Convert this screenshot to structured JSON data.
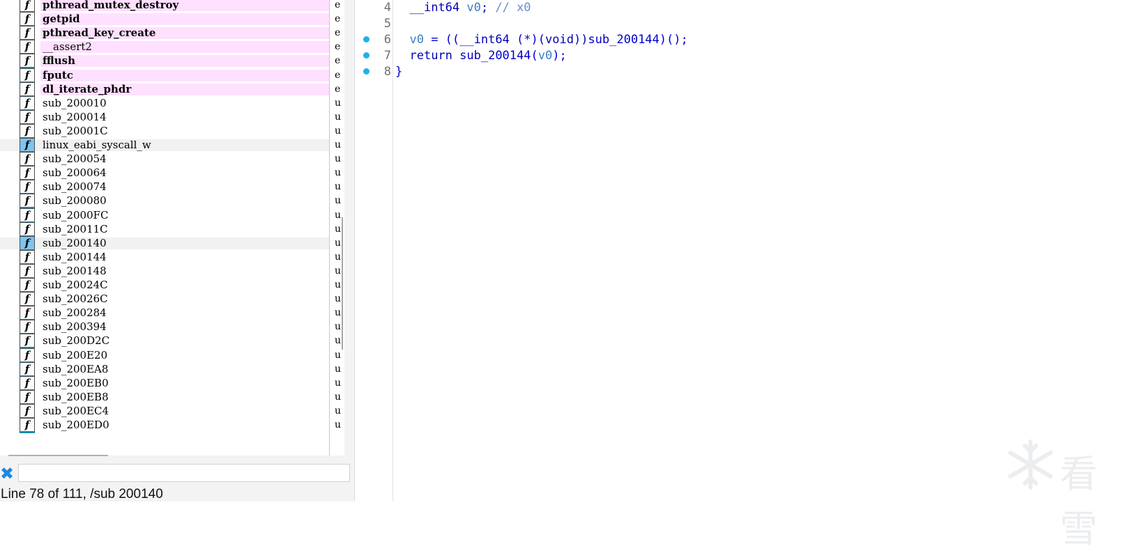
{
  "functions": [
    {
      "name": "pthread_mutex_destroy",
      "seg": "e",
      "type": "lib"
    },
    {
      "name": "getpid",
      "seg": "e",
      "type": "lib"
    },
    {
      "name": "pthread_key_create",
      "seg": "e",
      "type": "lib"
    },
    {
      "name": "__assert2",
      "seg": "e",
      "type": "lib-light"
    },
    {
      "name": "fflush",
      "seg": "e",
      "type": "lib"
    },
    {
      "name": "fputc",
      "seg": "e",
      "type": "lib"
    },
    {
      "name": "dl_iterate_phdr",
      "seg": "e",
      "type": "lib"
    },
    {
      "name": "sub_200010",
      "seg": "u",
      "type": "normal"
    },
    {
      "name": "sub_200014",
      "seg": "u",
      "type": "normal"
    },
    {
      "name": "sub_20001C",
      "seg": "u",
      "type": "normal"
    },
    {
      "name": "linux_eabi_syscall_w",
      "seg": "u",
      "type": "hover"
    },
    {
      "name": "sub_200054",
      "seg": "u",
      "type": "normal"
    },
    {
      "name": "sub_200064",
      "seg": "u",
      "type": "normal"
    },
    {
      "name": "sub_200074",
      "seg": "u",
      "type": "normal"
    },
    {
      "name": "sub_200080",
      "seg": "u",
      "type": "normal"
    },
    {
      "name": "sub_2000FC",
      "seg": "u",
      "type": "normal"
    },
    {
      "name": "sub_20011C",
      "seg": "u",
      "type": "normal"
    },
    {
      "name": "sub_200140",
      "seg": "u",
      "type": "selected"
    },
    {
      "name": "sub_200144",
      "seg": "u",
      "type": "normal"
    },
    {
      "name": "sub_200148",
      "seg": "u",
      "type": "normal"
    },
    {
      "name": "sub_20024C",
      "seg": "u",
      "type": "normal"
    },
    {
      "name": "sub_20026C",
      "seg": "u",
      "type": "normal"
    },
    {
      "name": "sub_200284",
      "seg": "u",
      "type": "normal"
    },
    {
      "name": "sub_200394",
      "seg": "u",
      "type": "normal"
    },
    {
      "name": "sub_200D2C",
      "seg": "u",
      "type": "normal"
    },
    {
      "name": "sub_200E20",
      "seg": "u",
      "type": "normal"
    },
    {
      "name": "sub_200EA8",
      "seg": "u",
      "type": "normal"
    },
    {
      "name": "sub_200EB0",
      "seg": "u",
      "type": "normal"
    },
    {
      "name": "sub_200EB8",
      "seg": "u",
      "type": "normal"
    },
    {
      "name": "sub_200EC4",
      "seg": "u",
      "type": "normal"
    },
    {
      "name": "sub_200ED0",
      "seg": "u",
      "type": "normal"
    }
  ],
  "function_icon_glyph": "f",
  "filter": {
    "value": "",
    "placeholder": ""
  },
  "status": "Line 78 of 111, /sub 200140",
  "code_lines": [
    {
      "num": "4",
      "breakpoint": false,
      "text": "  __int64 v0; // x0"
    },
    {
      "num": "5",
      "breakpoint": false,
      "text": ""
    },
    {
      "num": "6",
      "breakpoint": true,
      "text": "  v0 = ((__int64 (*)(void))sub_200144)();"
    },
    {
      "num": "7",
      "breakpoint": true,
      "text": "  return sub_200144(v0);"
    },
    {
      "num": "8",
      "breakpoint": true,
      "text": "}"
    }
  ],
  "watermark": {
    "text": "看雪"
  },
  "colors": {
    "library_highlight": "#ffe0ff",
    "selected_icon": "#7fc4ee",
    "breakpoint_dot": "#1fb2e8",
    "code_text": "#0000cc"
  }
}
